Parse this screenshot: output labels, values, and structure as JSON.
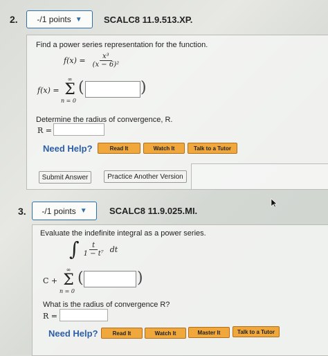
{
  "q2": {
    "number": "2.",
    "points": "-/1 points",
    "code": "SCALC8 11.9.513.XP.",
    "prompt": "Find a power series representation for the function.",
    "func_lhs": "f(x) =",
    "func_num": "x³",
    "func_den": "(x − 6)²",
    "sum_lhs": "f(x) =",
    "sum_top": "∞",
    "sum_bottom": "n = 0",
    "radius_prompt": "Determine the radius of convergence, R.",
    "radius_label": "R =",
    "need_help": "Need Help?",
    "help_buttons": [
      "Read It",
      "Watch It",
      "Talk to a Tutor"
    ],
    "submit": "Submit Answer",
    "practice": "Practice Another Version"
  },
  "q3": {
    "number": "3.",
    "points": "-/1 points",
    "code": "SCALC8 11.9.025.MI.",
    "prompt": "Evaluate the indefinite integral as a power series.",
    "integrand_num": "t",
    "integrand_den": "1 − t⁷",
    "dt": "dt",
    "sum_lhs": "C +",
    "sum_top": "∞",
    "sum_bottom": "n = 0",
    "radius_prompt": "What is the radius of convergence R?",
    "radius_label": "R =",
    "need_help": "Need Help?",
    "help_buttons": [
      "Read It",
      "Watch It",
      "Master It",
      "Talk to a Tutor"
    ]
  }
}
